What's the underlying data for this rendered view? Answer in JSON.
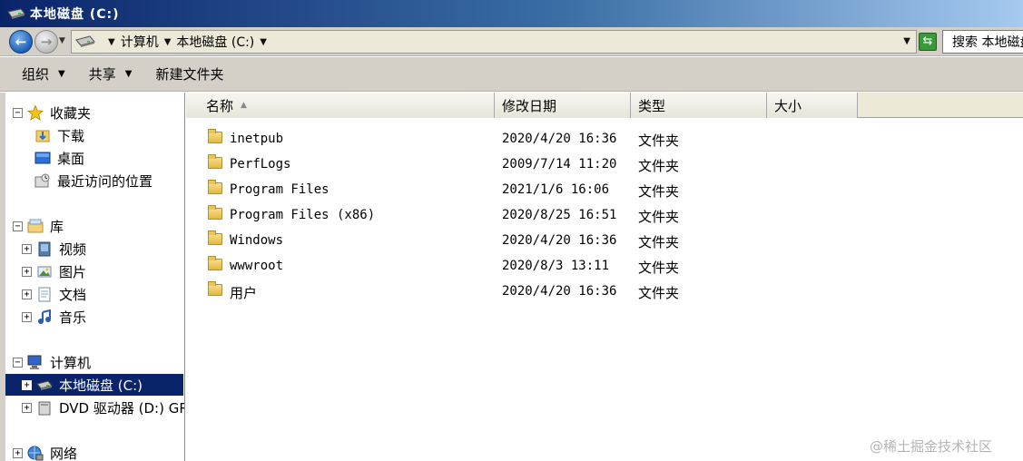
{
  "window": {
    "title": "本地磁盘 (C:)"
  },
  "address": {
    "crumbs": [
      "计算机",
      "本地磁盘 (C:)"
    ],
    "search_placeholder": "搜索 本地磁盘 (C:)"
  },
  "toolbar": {
    "organize": "组织",
    "share": "共享",
    "new_folder": "新建文件夹"
  },
  "nav": {
    "favorites": {
      "label": "收藏夹",
      "items": [
        "下载",
        "桌面",
        "最近访问的位置"
      ]
    },
    "libraries": {
      "label": "库",
      "items": [
        "视频",
        "图片",
        "文档",
        "音乐"
      ]
    },
    "computer": {
      "label": "计算机",
      "items": [
        "本地磁盘 (C:)",
        "DVD 驱动器 (D:) GR"
      ]
    },
    "network": {
      "label": "网络"
    },
    "selected": "本地磁盘 (C:)"
  },
  "columns": [
    "名称",
    "修改日期",
    "类型",
    "大小"
  ],
  "files": [
    {
      "name": "inetpub",
      "date": "2020/4/20 16:36",
      "type": "文件夹"
    },
    {
      "name": "PerfLogs",
      "date": "2009/7/14 11:20",
      "type": "文件夹"
    },
    {
      "name": "Program Files",
      "date": "2021/1/6 16:06",
      "type": "文件夹"
    },
    {
      "name": "Program Files (x86)",
      "date": "2020/8/25 16:51",
      "type": "文件夹"
    },
    {
      "name": "Windows",
      "date": "2020/4/20 16:36",
      "type": "文件夹"
    },
    {
      "name": "wwwroot",
      "date": "2020/8/3 13:11",
      "type": "文件夹"
    },
    {
      "name": "用户",
      "date": "2020/4/20 16:36",
      "type": "文件夹"
    }
  ],
  "watermark": "@稀土掘金技术社区",
  "icons": {
    "title": "drive-icon",
    "back": "back-arrow-icon",
    "forward": "forward-arrow-icon",
    "refresh": "refresh-icon",
    "folder": "folder-icon"
  }
}
